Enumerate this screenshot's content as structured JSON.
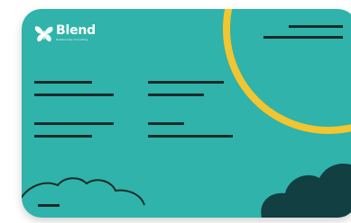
{
  "brand": {
    "name": "Blend",
    "tagline": "Relationship Consulting"
  },
  "colors": {
    "card_bg": "#2fb3aa",
    "line": "#1d2b2a",
    "accent_ring": "#f3c530",
    "cloud_dark": "#123f41",
    "logo_fg": "#ffffff"
  },
  "icons": {
    "logo": "butterfly-logo-icon"
  }
}
